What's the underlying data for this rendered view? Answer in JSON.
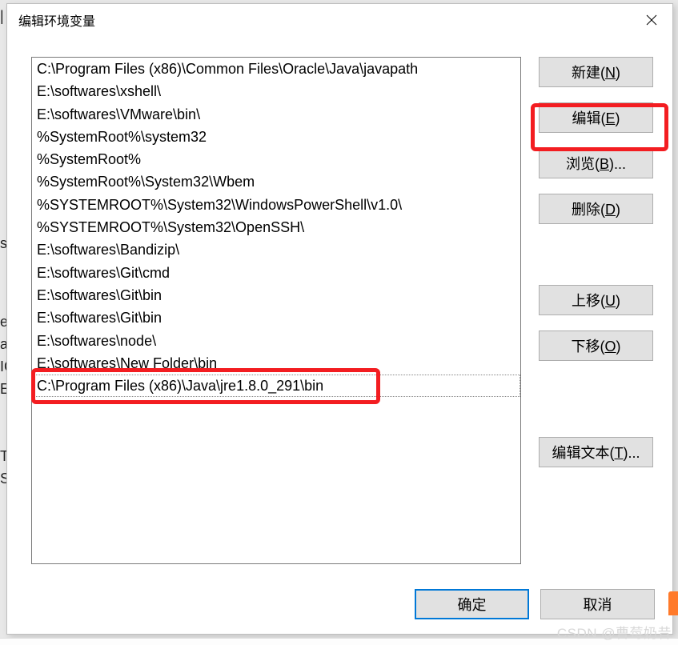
{
  "bg_fragments": [
    "|",
    "s)",
    "",
    "",
    "",
    "e",
    "a",
    "IC",
    "ER",
    "",
    "",
    "T",
    "S"
  ],
  "dialog": {
    "title": "编辑环境变量"
  },
  "list_items": [
    "C:\\Program Files (x86)\\Common Files\\Oracle\\Java\\javapath",
    "E:\\softwares\\xshell\\",
    "E:\\softwares\\VMware\\bin\\",
    "%SystemRoot%\\system32",
    "%SystemRoot%",
    "%SystemRoot%\\System32\\Wbem",
    "%SYSTEMROOT%\\System32\\WindowsPowerShell\\v1.0\\",
    "%SYSTEMROOT%\\System32\\OpenSSH\\",
    "E:\\softwares\\Bandizip\\",
    "E:\\softwares\\Git\\cmd",
    "E:\\softwares\\Git\\bin",
    "E:\\softwares\\Git\\bin",
    "E:\\softwares\\node\\",
    "E:\\softwares\\New Folder\\bin",
    "C:\\Program Files (x86)\\Java\\jre1.8.0_291\\bin"
  ],
  "selected_index": 14,
  "buttons": {
    "new": {
      "label": "新建",
      "accel": "N"
    },
    "edit": {
      "label": "编辑",
      "accel": "E"
    },
    "browse": {
      "label": "浏览",
      "accel": "B",
      "suffix": "..."
    },
    "delete": {
      "label": "删除",
      "accel": "D"
    },
    "moveup": {
      "label": "上移",
      "accel": "U"
    },
    "movedown": {
      "label": "下移",
      "accel": "O"
    },
    "edittext": {
      "label": "编辑文本",
      "accel": "T",
      "suffix": "..."
    },
    "ok": {
      "label": "确定"
    },
    "cancel": {
      "label": "取消"
    }
  },
  "watermark": "CSDN @曹莓奶昔"
}
